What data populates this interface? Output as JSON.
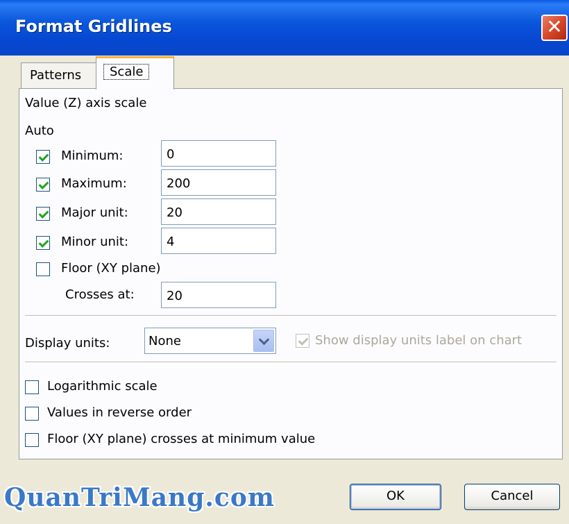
{
  "window": {
    "title": "Format Gridlines",
    "close_glyph": "✕"
  },
  "tabs": [
    {
      "label": "Patterns"
    },
    {
      "label": "Scale"
    }
  ],
  "scale": {
    "heading": "Value (Z) axis scale",
    "auto_label": "Auto",
    "minimum": {
      "label": "Minimum:",
      "checked": true,
      "value": "0"
    },
    "maximum": {
      "label": "Maximum:",
      "checked": true,
      "value": "200"
    },
    "major_unit": {
      "label": "Major unit:",
      "checked": true,
      "value": "20"
    },
    "minor_unit": {
      "label": "Minor unit:",
      "checked": true,
      "value": "4"
    },
    "floor": {
      "label": "Floor (XY plane)",
      "checked": false
    },
    "crosses_at": {
      "label": "Crosses at:",
      "value": "20"
    },
    "display_units": {
      "label": "Display units:",
      "selected": "None"
    },
    "show_units_label": {
      "label": "Show display units label on chart",
      "checked": true,
      "enabled": false
    },
    "logarithmic": {
      "label": "Logarithmic scale",
      "checked": false
    },
    "reverse_order": {
      "label": "Values in reverse order",
      "checked": false
    },
    "floor_min": {
      "label": "Floor (XY plane) crosses at minimum value",
      "checked": false
    }
  },
  "buttons": {
    "ok": "OK",
    "cancel": "Cancel"
  },
  "watermark": "QuanTriMang.com",
  "colors": {
    "titlebar": "#0a56dc",
    "dialog_bg": "#ece9d8",
    "check": "#21a121",
    "close": "#d8482a"
  }
}
